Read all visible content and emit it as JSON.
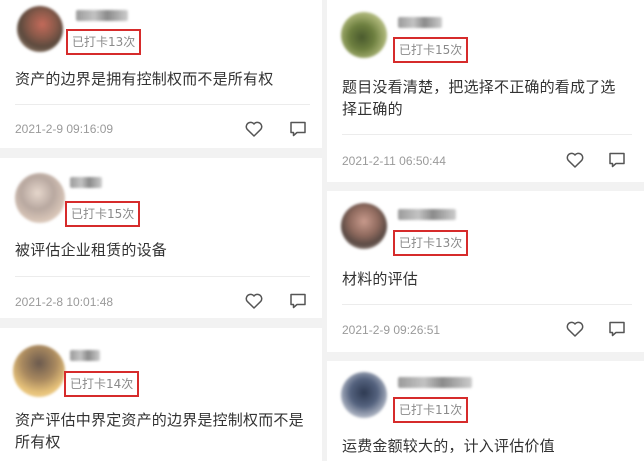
{
  "posts": [
    {
      "checkin": "已打卡13次",
      "content": "资产的边界是拥有控制权而不是所有权",
      "timestamp": "2021-2-9 09:16:09"
    },
    {
      "checkin": "已打卡15次",
      "content": "被评估企业租赁的设备",
      "timestamp": "2021-2-8 10:01:48"
    },
    {
      "checkin": "已打卡14次",
      "content": "资产评估中界定资产的边界是控制权而不是所有权",
      "timestamp": ""
    },
    {
      "checkin": "已打卡15次",
      "content": "题目没看清楚，把选择不正确的看成了选择正确的",
      "timestamp": "2021-2-11 06:50:44"
    },
    {
      "checkin": "已打卡13次",
      "content": "材料的评估",
      "timestamp": "2021-2-9 09:26:51"
    },
    {
      "checkin": "已打卡11次",
      "content": "运费金额较大的，计入评估价值",
      "timestamp": ""
    }
  ],
  "icons": {
    "like": "heart-outline-icon",
    "comment": "comment-bubble-icon"
  },
  "colors": {
    "checkin_border": "#d62b2b",
    "page_bg": "#f2f2f2",
    "card_bg": "#ffffff",
    "text": "#333333",
    "muted": "#9a9a9a"
  }
}
